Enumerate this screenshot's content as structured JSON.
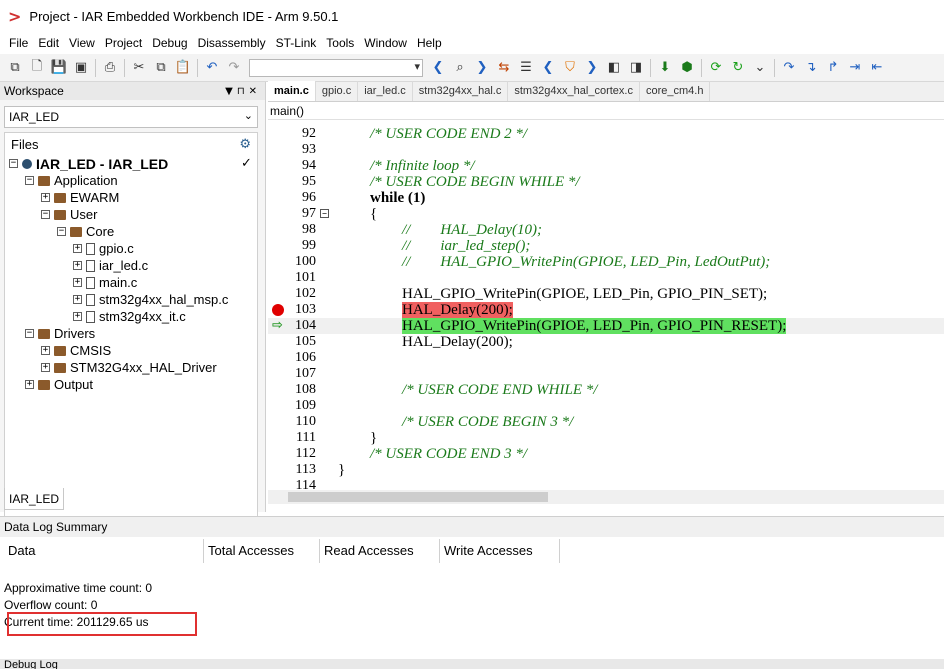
{
  "title": "Project - IAR Embedded Workbench IDE - Arm 9.50.1",
  "menu": [
    "File",
    "Edit",
    "View",
    "Project",
    "Debug",
    "Disassembly",
    "ST-Link",
    "Tools",
    "Window",
    "Help"
  ],
  "workspace": {
    "header": "Workspace",
    "project_combo": "IAR_LED",
    "files_label": "Files",
    "tab": "IAR_LED",
    "tree": [
      {
        "label": "IAR_LED - IAR_LED",
        "type": "project",
        "depth": 0,
        "exp": "−"
      },
      {
        "label": "Application",
        "type": "folder",
        "depth": 1,
        "exp": "−"
      },
      {
        "label": "EWARM",
        "type": "folder",
        "depth": 2,
        "exp": "+"
      },
      {
        "label": "User",
        "type": "folder",
        "depth": 2,
        "exp": "−"
      },
      {
        "label": "Core",
        "type": "folder",
        "depth": 3,
        "exp": "−"
      },
      {
        "label": "gpio.c",
        "type": "file",
        "depth": 4,
        "exp": "+"
      },
      {
        "label": "iar_led.c",
        "type": "file",
        "depth": 4,
        "exp": "+"
      },
      {
        "label": "main.c",
        "type": "file",
        "depth": 4,
        "exp": "+"
      },
      {
        "label": "stm32g4xx_hal_msp.c",
        "type": "file",
        "depth": 4,
        "exp": "+"
      },
      {
        "label": "stm32g4xx_it.c",
        "type": "file",
        "depth": 4,
        "exp": "+"
      },
      {
        "label": "Drivers",
        "type": "folder",
        "depth": 1,
        "exp": "−"
      },
      {
        "label": "CMSIS",
        "type": "folder",
        "depth": 2,
        "exp": "+"
      },
      {
        "label": "STM32G4xx_HAL_Driver",
        "type": "folder",
        "depth": 2,
        "exp": "+"
      },
      {
        "label": "Output",
        "type": "folder",
        "depth": 1,
        "exp": "+"
      }
    ]
  },
  "editor": {
    "tabs": [
      "main.c",
      "gpio.c",
      "iar_led.c",
      "stm32g4xx_hal.c",
      "stm32g4xx_hal_cortex.c",
      "core_cm4.h"
    ],
    "active_tab": "main.c",
    "function": "main()",
    "lines": [
      {
        "n": "92",
        "text": "/* USER CODE END 2 */",
        "cls": "cm",
        "indent": 2
      },
      {
        "n": "93",
        "text": "",
        "cls": "",
        "indent": 0
      },
      {
        "n": "94",
        "text": "/* Infinite loop */",
        "cls": "cm",
        "indent": 2
      },
      {
        "n": "95",
        "text": "/* USER CODE BEGIN WHILE */",
        "cls": "cm",
        "indent": 2
      },
      {
        "n": "96",
        "text": "while (1)",
        "cls": "kw",
        "indent": 2
      },
      {
        "n": "97",
        "text": "{",
        "cls": "",
        "indent": 2,
        "fold": "−"
      },
      {
        "n": "98",
        "text": "//        HAL_Delay(10);",
        "cls": "cm",
        "indent": 4
      },
      {
        "n": "99",
        "text": "//        iar_led_step();",
        "cls": "cm",
        "indent": 4
      },
      {
        "n": "100",
        "text": "//        HAL_GPIO_WritePin(GPIOE, LED_Pin, LedOutPut);",
        "cls": "cm",
        "indent": 4
      },
      {
        "n": "101",
        "text": "",
        "cls": "",
        "indent": 0
      },
      {
        "n": "102",
        "text": "HAL_GPIO_WritePin(GPIOE, LED_Pin, GPIO_PIN_SET);",
        "cls": "",
        "indent": 4
      },
      {
        "n": "103",
        "text": "HAL_Delay(200);",
        "cls": "hl-red",
        "indent": 4,
        "bp": true
      },
      {
        "n": "104",
        "text": "HAL_GPIO_WritePin(GPIOE, LED_Pin, GPIO_PIN_RESET);",
        "cls": "hl-green",
        "indent": 4,
        "pc": true
      },
      {
        "n": "105",
        "text": "HAL_Delay(200);",
        "cls": "",
        "indent": 4
      },
      {
        "n": "106",
        "text": "",
        "cls": "",
        "indent": 0
      },
      {
        "n": "107",
        "text": "",
        "cls": "",
        "indent": 0
      },
      {
        "n": "108",
        "text": "/* USER CODE END WHILE */",
        "cls": "cm",
        "indent": 4
      },
      {
        "n": "109",
        "text": "",
        "cls": "",
        "indent": 0
      },
      {
        "n": "110",
        "text": "/* USER CODE BEGIN 3 */",
        "cls": "cm",
        "indent": 4
      },
      {
        "n": "111",
        "text": "}",
        "cls": "",
        "indent": 2
      },
      {
        "n": "112",
        "text": "/* USER CODE END 3 */",
        "cls": "cm",
        "indent": 2
      },
      {
        "n": "113",
        "text": "}",
        "cls": "",
        "indent": 0
      },
      {
        "n": "114",
        "text": "",
        "cls": "",
        "indent": 0
      }
    ]
  },
  "datalog": {
    "title": "Data Log Summary",
    "columns": [
      "Data",
      "Total Accesses",
      "Read Accesses",
      "Write Accesses"
    ],
    "approx_time": "Approximative time count: 0",
    "overflow": "Overflow count: 0",
    "current_time": "Current time: 201129.65 us"
  },
  "bottom_panel": "Debug Log"
}
